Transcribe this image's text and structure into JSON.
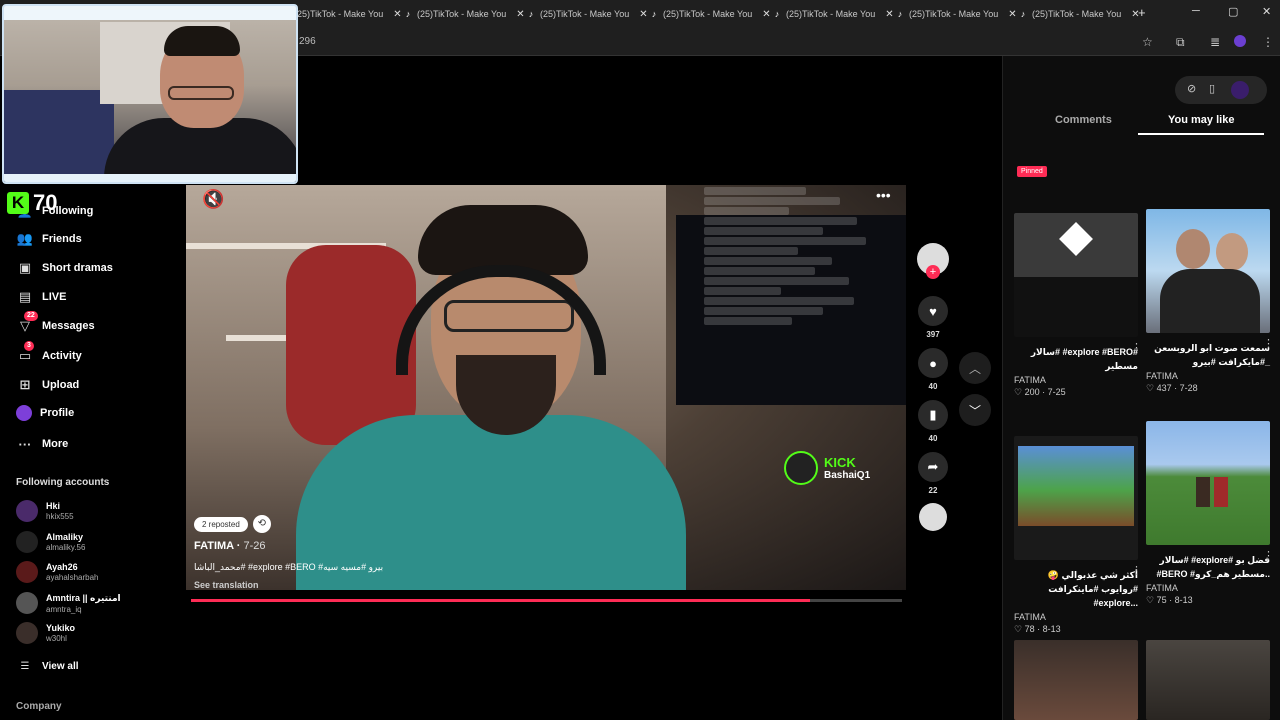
{
  "browser": {
    "tab_title": "(25)TikTok - Make You",
    "url": "296"
  },
  "webcam_badge": {
    "label": "70"
  },
  "sidebar": {
    "nav": [
      {
        "label": "Following",
        "icon": "following-icon"
      },
      {
        "label": "Friends",
        "icon": "friends-icon"
      },
      {
        "label": "Short dramas",
        "icon": "short-dramas-icon"
      },
      {
        "label": "LIVE",
        "icon": "live-icon"
      },
      {
        "label": "Messages",
        "icon": "messages-icon",
        "badge": "22"
      },
      {
        "label": "Activity",
        "icon": "activity-icon",
        "badge": "3"
      },
      {
        "label": "Upload",
        "icon": "upload-icon"
      },
      {
        "label": "Profile",
        "icon": "profile-icon"
      },
      {
        "label": "More",
        "icon": "more-icon"
      }
    ],
    "following_title": "Following accounts",
    "accounts": [
      {
        "name": "Hki",
        "handle": "hkix555"
      },
      {
        "name": "Almaliky",
        "handle": "almaliky.56"
      },
      {
        "name": "Ayah26",
        "handle": "ayahalsharbah"
      },
      {
        "name": "Amntira || امنتيره",
        "handle": "amntra_iq"
      },
      {
        "name": "Yukiko",
        "handle": "w30hl"
      }
    ],
    "view_all": "View all",
    "company": "Company"
  },
  "video": {
    "reposted": "2 reposted",
    "author": "FATIMA",
    "date": "7-26",
    "description": "محمد_الباشا# #explore #BERO #بيرو #مسيه سيه",
    "see_translation": "See translation",
    "kick_brand": "KICK",
    "kick_user": "BashaiQ1",
    "progress_fraction": 0.87
  },
  "actions": {
    "likes": "397",
    "comments": "40",
    "saves": "40",
    "shares": "22"
  },
  "panel": {
    "tab_comments": "Comments",
    "tab_you_may_like": "You may like",
    "pinned": "Pinned",
    "cards": [
      {
        "caption": "سالار# #explore #BERO# مسطير",
        "author": "FATIMA",
        "likes": "200",
        "date": "7-25"
      },
      {
        "caption": "سمعت صوت ابو الروبسعن _#مايكرافت #بيرو",
        "author": "FATIMA",
        "likes": "437",
        "date": "7-28"
      },
      {
        "caption": "أكثر شي عذبوالي 🤪 #روايوب #ماينكرافت #explore...",
        "author": "FATIMA",
        "likes": "78",
        "date": "8-13"
      },
      {
        "caption": "سالار# #explore# فضل بو #BERO #مسطير هم_كرو..",
        "author": "FATIMA",
        "likes": "75",
        "date": "8-13"
      }
    ]
  },
  "colors": {
    "accent": "#fe2c55",
    "kick": "#53fc18"
  }
}
